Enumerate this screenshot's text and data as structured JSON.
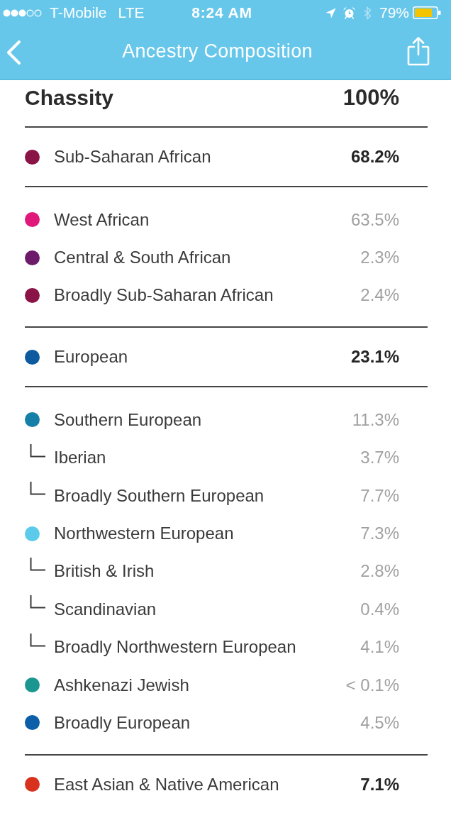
{
  "status_bar": {
    "carrier": "T-Mobile",
    "network": "LTE",
    "time": "8:24 AM",
    "battery": "79%"
  },
  "nav_bar": {
    "title": "Ancestry Composition"
  },
  "profile": {
    "name": "Chassity",
    "percent": "100%"
  },
  "regions": [
    {
      "name": "Sub-Saharan African",
      "percent": "68.2%",
      "color": "#8a1446",
      "subregions": [
        {
          "name": "West African",
          "percent": "63.5%",
          "color": "#e0187a"
        },
        {
          "name": "Central & South African",
          "percent": "2.3%",
          "color": "#6d1a6a"
        },
        {
          "name": "Broadly Sub-Saharan African",
          "percent": "2.4%",
          "color": "#8a1446"
        }
      ]
    },
    {
      "name": "European",
      "percent": "23.1%",
      "color": "#0d5a9e",
      "subregions": [
        {
          "name": "Southern European",
          "percent": "11.3%",
          "color": "#1480a8",
          "children": [
            {
              "name": "Iberian",
              "percent": "3.7%"
            },
            {
              "name": "Broadly Southern European",
              "percent": "7.7%"
            }
          ]
        },
        {
          "name": "Northwestern European",
          "percent": "7.3%",
          "color": "#5ccbeb",
          "children": [
            {
              "name": "British & Irish",
              "percent": "2.8%"
            },
            {
              "name": "Scandinavian",
              "percent": "0.4%"
            },
            {
              "name": "Broadly Northwestern European",
              "percent": "4.1%"
            }
          ]
        },
        {
          "name": "Ashkenazi Jewish",
          "percent": "< 0.1%",
          "color": "#1b9690"
        },
        {
          "name": "Broadly European",
          "percent": "4.5%",
          "color": "#0d5ea8"
        }
      ]
    },
    {
      "name": "East Asian & Native American",
      "percent": "7.1%",
      "color": "#d8321e"
    }
  ]
}
